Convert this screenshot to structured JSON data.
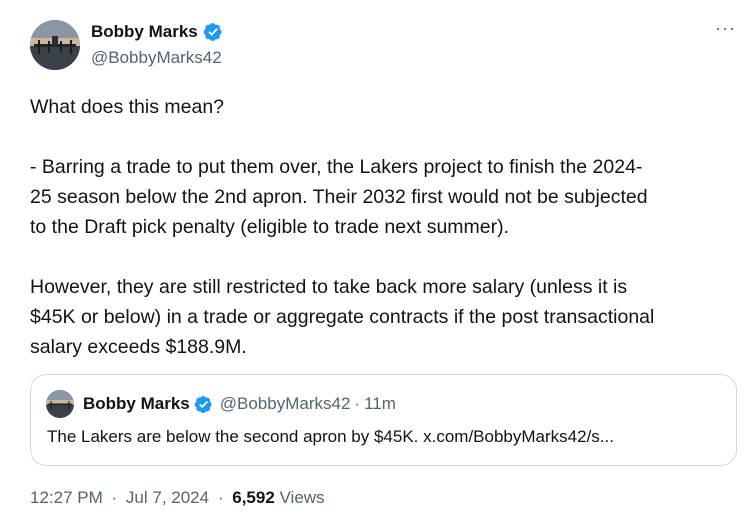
{
  "author": {
    "name": "Bobby Marks",
    "handle": "@BobbyMarks42",
    "verified_icon": "verified-badge-icon",
    "avatar_icon": "pier-sunset-avatar"
  },
  "more_icon": "ellipsis-icon",
  "body": {
    "paragraphs": [
      "What does this mean?",
      "- Barring a trade to put them over, the Lakers project to finish the 2024-\n25 season below the 2nd apron. Their 2032 first would not be subjected\nto the Draft pick penalty (eligible to trade next summer).",
      "However, they are still restricted to take back more salary (unless it is\n$45K or below) in a trade or aggregate contracts if the post transactional\nsalary exceeds $188.9M."
    ]
  },
  "quote": {
    "name": "Bobby Marks",
    "handle": "@BobbyMarks42",
    "separator": "·",
    "time": "11m",
    "text": "The Lakers are below the second apron by $45K. x.com/BobbyMarks42/s..."
  },
  "meta": {
    "time": "12:27 PM",
    "separator": "·",
    "date": "Jul 7, 2024",
    "views_count": "6,592",
    "views_label": "Views"
  },
  "colors": {
    "text": "#0f1419",
    "secondary": "#536471",
    "verified": "#1d9bf0",
    "border": "#cfd9de"
  }
}
